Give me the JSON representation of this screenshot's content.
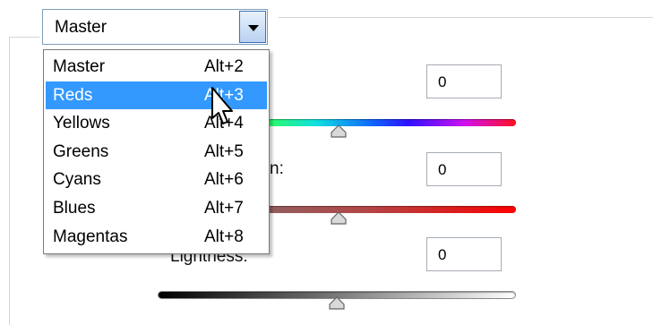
{
  "dropdown": {
    "selected_value": "Master",
    "items": [
      {
        "label": "Master",
        "shortcut": "Alt+2"
      },
      {
        "label": "Reds",
        "shortcut": "Alt+3"
      },
      {
        "label": "Yellows",
        "shortcut": "Alt+4"
      },
      {
        "label": "Greens",
        "shortcut": "Alt+5"
      },
      {
        "label": "Cyans",
        "shortcut": "Alt+6"
      },
      {
        "label": "Blues",
        "shortcut": "Alt+7"
      },
      {
        "label": "Magentas",
        "shortcut": "Alt+8"
      }
    ],
    "highlighted_index": 1,
    "highlight_color": "#3399ff"
  },
  "hue": {
    "value": "0"
  },
  "saturation": {
    "label_fragment": "n:",
    "value": "0"
  },
  "lightness": {
    "label_fragment": "Lightness:",
    "value": "0"
  },
  "sliders": {
    "hue_level": 0.5,
    "saturation_level": 0.5,
    "lightness_level": 0.5
  },
  "icons": [
    "dropdown-arrow-icon",
    "slider-thumb-icon",
    "mouse-cursor-icon"
  ]
}
